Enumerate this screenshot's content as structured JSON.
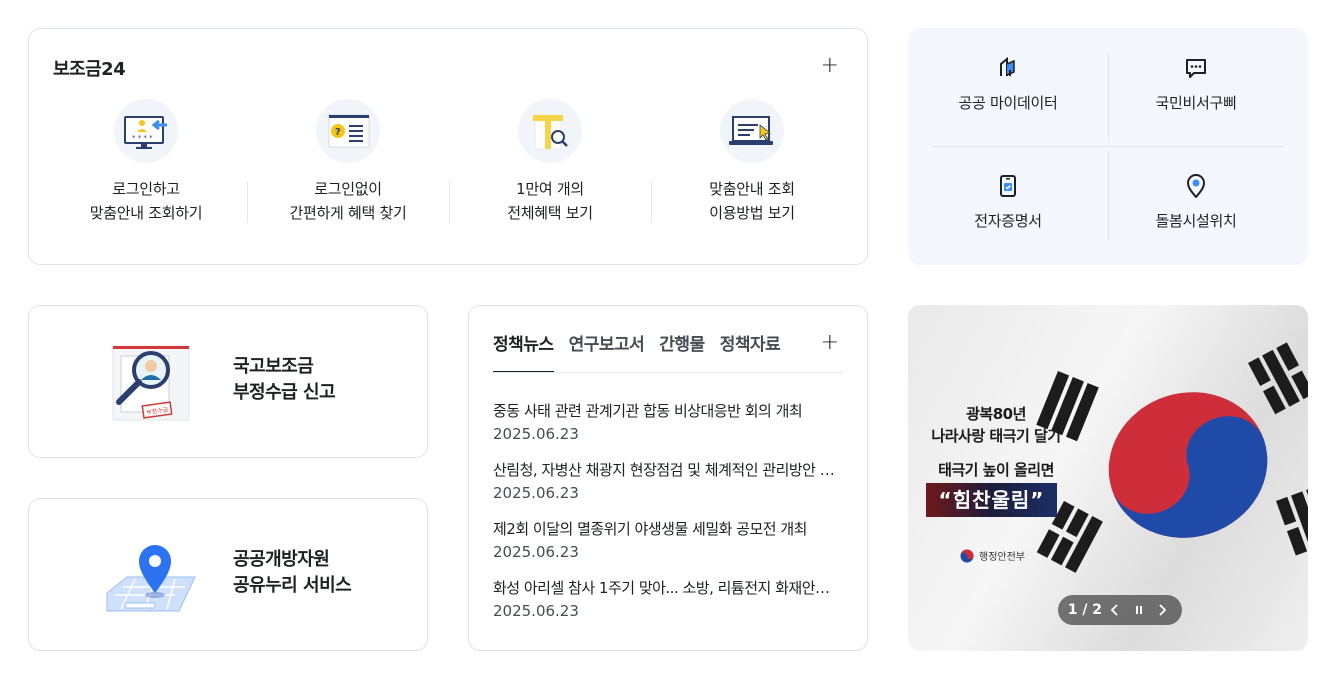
{
  "subsidy": {
    "title": "보조금24",
    "items": [
      {
        "line1": "로그인하고",
        "line2": "맞춤안내 조회하기",
        "icon": "login-monitor-icon"
      },
      {
        "line1": "로그인없이",
        "line2": "간편하게 혜택 찾기",
        "icon": "question-document-icon"
      },
      {
        "line1": "1만여 개의",
        "line2": "전체혜택 보기",
        "icon": "gift-search-icon"
      },
      {
        "line1": "맞춤안내 조회",
        "line2": "이용방법 보기",
        "icon": "laptop-guide-icon"
      }
    ]
  },
  "quick_menu": {
    "items": [
      {
        "label": "공공 마이데이터",
        "icon": "mydata-icon"
      },
      {
        "label": "국민비서구삐",
        "icon": "chat-icon"
      },
      {
        "label": "전자증명서",
        "icon": "certificate-icon"
      },
      {
        "label": "돌봄시설위치",
        "icon": "location-pin-icon"
      }
    ]
  },
  "banners": {
    "report": {
      "line1": "국고보조금",
      "line2": "부정수급 신고",
      "stamp": "부정수급"
    },
    "opendata": {
      "line1": "공공개방자원",
      "line2": "공유누리 서비스"
    }
  },
  "news": {
    "tabs": [
      "정책뉴스",
      "연구보고서",
      "간행물",
      "정책자료"
    ],
    "active_tab": 0,
    "items": [
      {
        "title": "중동 사태 관련 관계기관 합동 비상대응반 회의 개최",
        "date": "2025.06.23"
      },
      {
        "title": "산림청, 자병산 채광지 현장점검 및 체계적인 관리방안 마련",
        "date": "2025.06.23"
      },
      {
        "title": "제2회 이달의 멸종위기 야생생물 세밀화 공모전 개최",
        "date": "2025.06.23"
      },
      {
        "title": "화성 아리셀 참사 1주기 맞아... 소방, 리튬전지 화재안전 강화",
        "date": "2025.06.23"
      }
    ]
  },
  "promo": {
    "line1": "광복80년",
    "line2": "나라사랑 태극기 달기",
    "line3": "태극기 높이 올리면",
    "slogan": "“힘찬울림”",
    "org": "행정안전부",
    "counter": "1 / 2"
  },
  "colors": {
    "accent": "#256ef4",
    "text": "#1e2124",
    "quick_bg": "#f4f7fd",
    "border": "#dfe3e8"
  }
}
